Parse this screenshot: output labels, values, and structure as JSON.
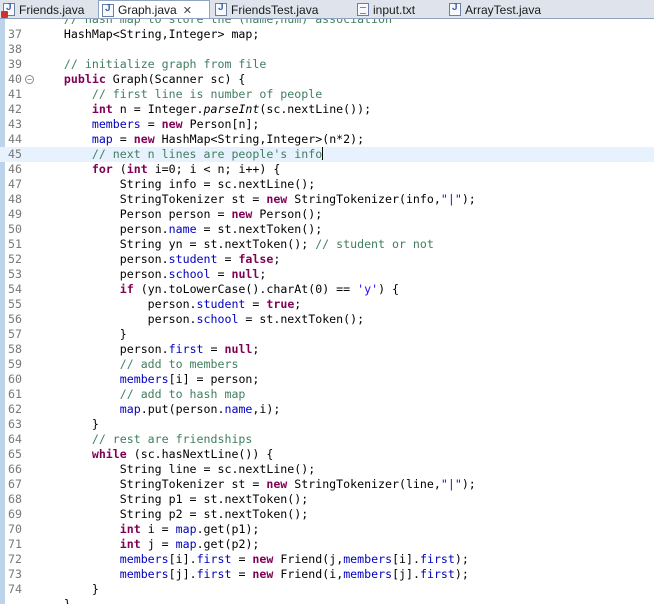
{
  "tabs": [
    {
      "label": "Friends.java",
      "icon": "java-file-error-icon",
      "active": false
    },
    {
      "label": "Graph.java",
      "icon": "java-file-icon",
      "active": true,
      "close": "✕"
    },
    {
      "label": "FriendsTest.java",
      "icon": "java-file-icon",
      "active": false
    },
    {
      "label": "input.txt",
      "icon": "text-file-icon",
      "active": false
    },
    {
      "label": "ArrayTest.java",
      "icon": "java-file-icon",
      "active": false
    }
  ],
  "current_line": 45,
  "lines": [
    {
      "n": "",
      "t": [
        {
          "c": "    // hash map to store the (name,num) association",
          "k": "cm"
        }
      ]
    },
    {
      "n": "37",
      "t": [
        {
          "c": "    HashMap<String,Integer> map;"
        }
      ]
    },
    {
      "n": "38",
      "t": []
    },
    {
      "n": "39",
      "t": [
        {
          "c": "    // initialize graph from file",
          "k": "cm"
        }
      ]
    },
    {
      "n": "40",
      "fold": "−",
      "t": [
        {
          "c": "    "
        },
        {
          "c": "public",
          "k": "kw"
        },
        {
          "c": " Graph(Scanner sc) {"
        }
      ]
    },
    {
      "n": "41",
      "t": [
        {
          "c": "        // first line is number of people",
          "k": "cm"
        }
      ]
    },
    {
      "n": "42",
      "t": [
        {
          "c": "        "
        },
        {
          "c": "int",
          "k": "kw"
        },
        {
          "c": " n = Integer."
        },
        {
          "c": "parseInt",
          "k": "sm"
        },
        {
          "c": "(sc.nextLine());"
        }
      ]
    },
    {
      "n": "43",
      "t": [
        {
          "c": "        "
        },
        {
          "c": "members",
          "k": "fld"
        },
        {
          "c": " = "
        },
        {
          "c": "new",
          "k": "kw"
        },
        {
          "c": " Person[n];"
        }
      ]
    },
    {
      "n": "44",
      "t": [
        {
          "c": "        "
        },
        {
          "c": "map",
          "k": "fld"
        },
        {
          "c": " = "
        },
        {
          "c": "new",
          "k": "kw"
        },
        {
          "c": " HashMap<String,Integer>(n*2);"
        }
      ]
    },
    {
      "n": "45",
      "caret": true,
      "t": [
        {
          "c": "        // next n lines are people's info",
          "k": "cm"
        }
      ]
    },
    {
      "n": "46",
      "t": [
        {
          "c": "        "
        },
        {
          "c": "for",
          "k": "kw"
        },
        {
          "c": " ("
        },
        {
          "c": "int",
          "k": "kw"
        },
        {
          "c": " i=0; i < n; i++) {"
        }
      ]
    },
    {
      "n": "47",
      "t": [
        {
          "c": "            String info = sc.nextLine();"
        }
      ]
    },
    {
      "n": "48",
      "t": [
        {
          "c": "            StringTokenizer st = "
        },
        {
          "c": "new",
          "k": "kw"
        },
        {
          "c": " StringTokenizer(info,"
        },
        {
          "c": "\"|\"",
          "k": "st"
        },
        {
          "c": ");"
        }
      ]
    },
    {
      "n": "49",
      "t": [
        {
          "c": "            Person person = "
        },
        {
          "c": "new",
          "k": "kw"
        },
        {
          "c": " Person();"
        }
      ]
    },
    {
      "n": "50",
      "t": [
        {
          "c": "            person."
        },
        {
          "c": "name",
          "k": "fld"
        },
        {
          "c": " = st.nextToken();"
        }
      ]
    },
    {
      "n": "51",
      "t": [
        {
          "c": "            String yn = st.nextToken(); "
        },
        {
          "c": "// student or not",
          "k": "cm"
        }
      ]
    },
    {
      "n": "52",
      "t": [
        {
          "c": "            person."
        },
        {
          "c": "student",
          "k": "fld"
        },
        {
          "c": " = "
        },
        {
          "c": "false",
          "k": "kw"
        },
        {
          "c": ";"
        }
      ]
    },
    {
      "n": "53",
      "t": [
        {
          "c": "            person."
        },
        {
          "c": "school",
          "k": "fld"
        },
        {
          "c": " = "
        },
        {
          "c": "null",
          "k": "kw"
        },
        {
          "c": ";"
        }
      ]
    },
    {
      "n": "54",
      "t": [
        {
          "c": "            "
        },
        {
          "c": "if",
          "k": "kw"
        },
        {
          "c": " (yn.toLowerCase().charAt(0) == "
        },
        {
          "c": "'y'",
          "k": "st"
        },
        {
          "c": ") {"
        }
      ]
    },
    {
      "n": "55",
      "t": [
        {
          "c": "                person."
        },
        {
          "c": "student",
          "k": "fld"
        },
        {
          "c": " = "
        },
        {
          "c": "true",
          "k": "kw"
        },
        {
          "c": ";"
        }
      ]
    },
    {
      "n": "56",
      "t": [
        {
          "c": "                person."
        },
        {
          "c": "school",
          "k": "fld"
        },
        {
          "c": " = st.nextToken();"
        }
      ]
    },
    {
      "n": "57",
      "t": [
        {
          "c": "            }"
        }
      ]
    },
    {
      "n": "58",
      "t": [
        {
          "c": "            person."
        },
        {
          "c": "first",
          "k": "fld"
        },
        {
          "c": " = "
        },
        {
          "c": "null",
          "k": "kw"
        },
        {
          "c": ";"
        }
      ]
    },
    {
      "n": "59",
      "t": [
        {
          "c": "            // add to members",
          "k": "cm"
        }
      ]
    },
    {
      "n": "60",
      "t": [
        {
          "c": "            "
        },
        {
          "c": "members",
          "k": "fld"
        },
        {
          "c": "[i] = person;"
        }
      ]
    },
    {
      "n": "61",
      "t": [
        {
          "c": "            // add to hash map",
          "k": "cm"
        }
      ]
    },
    {
      "n": "62",
      "t": [
        {
          "c": "            "
        },
        {
          "c": "map",
          "k": "fld"
        },
        {
          "c": ".put(person."
        },
        {
          "c": "name",
          "k": "fld"
        },
        {
          "c": ",i);"
        }
      ]
    },
    {
      "n": "63",
      "t": [
        {
          "c": "        }"
        }
      ]
    },
    {
      "n": "64",
      "t": [
        {
          "c": "        // rest are friendships",
          "k": "cm"
        }
      ]
    },
    {
      "n": "65",
      "t": [
        {
          "c": "        "
        },
        {
          "c": "while",
          "k": "kw"
        },
        {
          "c": " (sc.hasNextLine()) {"
        }
      ]
    },
    {
      "n": "66",
      "t": [
        {
          "c": "            String line = sc.nextLine();"
        }
      ]
    },
    {
      "n": "67",
      "t": [
        {
          "c": "            StringTokenizer st = "
        },
        {
          "c": "new",
          "k": "kw"
        },
        {
          "c": " StringTokenizer(line,"
        },
        {
          "c": "\"|\"",
          "k": "st"
        },
        {
          "c": ");"
        }
      ]
    },
    {
      "n": "68",
      "t": [
        {
          "c": "            String p1 = st.nextToken();"
        }
      ]
    },
    {
      "n": "69",
      "t": [
        {
          "c": "            String p2 = st.nextToken();"
        }
      ]
    },
    {
      "n": "70",
      "t": [
        {
          "c": "            "
        },
        {
          "c": "int",
          "k": "kw"
        },
        {
          "c": " i = "
        },
        {
          "c": "map",
          "k": "fld"
        },
        {
          "c": ".get(p1);"
        }
      ]
    },
    {
      "n": "71",
      "t": [
        {
          "c": "            "
        },
        {
          "c": "int",
          "k": "kw"
        },
        {
          "c": " j = "
        },
        {
          "c": "map",
          "k": "fld"
        },
        {
          "c": ".get(p2);"
        }
      ]
    },
    {
      "n": "72",
      "t": [
        {
          "c": "            "
        },
        {
          "c": "members",
          "k": "fld"
        },
        {
          "c": "[i]."
        },
        {
          "c": "first",
          "k": "fld"
        },
        {
          "c": " = "
        },
        {
          "c": "new",
          "k": "kw"
        },
        {
          "c": " Friend(j,"
        },
        {
          "c": "members",
          "k": "fld"
        },
        {
          "c": "[i]."
        },
        {
          "c": "first",
          "k": "fld"
        },
        {
          "c": ");"
        }
      ]
    },
    {
      "n": "73",
      "t": [
        {
          "c": "            "
        },
        {
          "c": "members",
          "k": "fld"
        },
        {
          "c": "[j]."
        },
        {
          "c": "first",
          "k": "fld"
        },
        {
          "c": " = "
        },
        {
          "c": "new",
          "k": "kw"
        },
        {
          "c": " Friend(i,"
        },
        {
          "c": "members",
          "k": "fld"
        },
        {
          "c": "[j]."
        },
        {
          "c": "first",
          "k": "fld"
        },
        {
          "c": ");"
        }
      ]
    },
    {
      "n": "74",
      "t": [
        {
          "c": "        }"
        }
      ]
    },
    {
      "n": "",
      "t": [
        {
          "c": "    }"
        }
      ]
    }
  ]
}
